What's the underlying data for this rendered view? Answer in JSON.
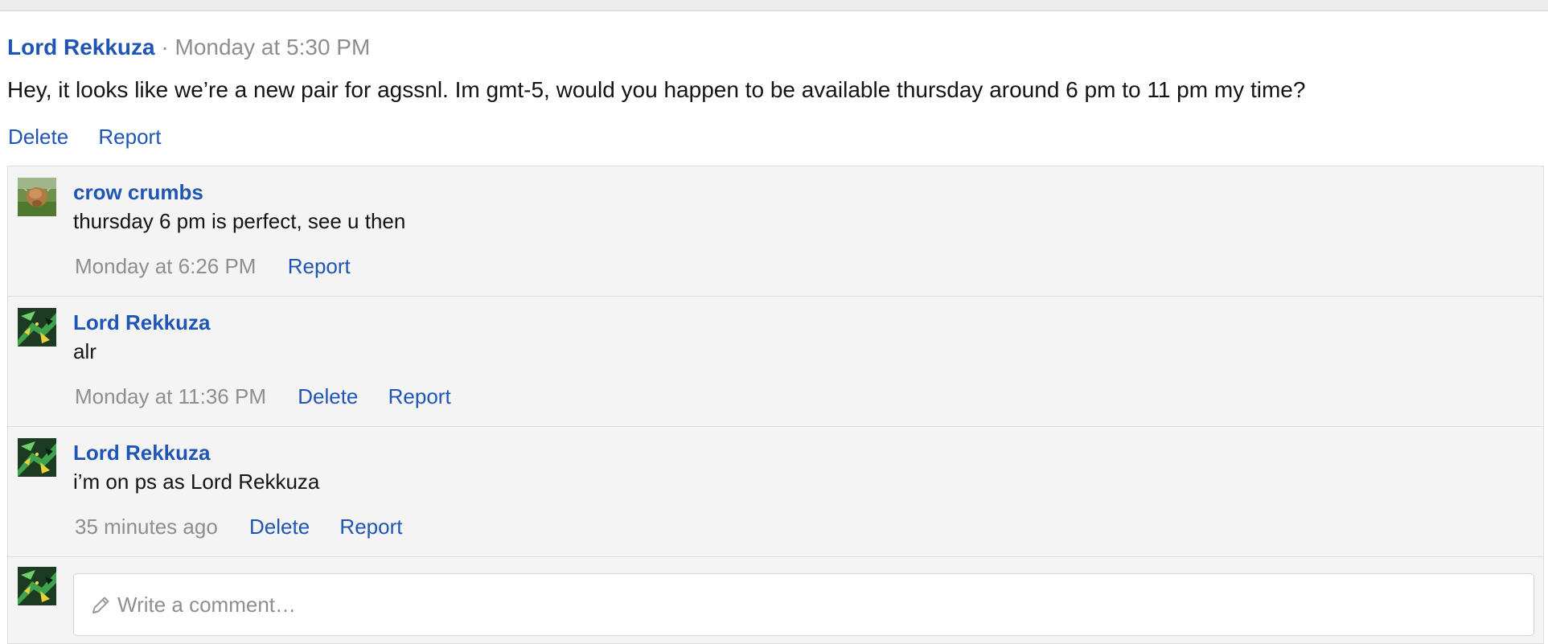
{
  "post": {
    "author": "Lord Rekkuza",
    "separator": "·",
    "timestamp": "Monday at 5:30 PM",
    "body": "Hey, it looks like we’re a new pair for agssnl. Im gmt-5, would you happen to be available thursday around 6 pm to 11 pm my time?",
    "actions": {
      "delete_label": "Delete",
      "report_label": "Report"
    }
  },
  "comments": [
    {
      "author": "crow crumbs",
      "text": "thursday 6 pm is perfect, see u then",
      "time": "Monday at 6:26 PM",
      "report_label": "Report",
      "avatar_icon": "highland-cow-photo"
    },
    {
      "author": "Lord Rekkuza",
      "text": "alr",
      "time": "Monday at 11:36 PM",
      "delete_label": "Delete",
      "report_label": "Report",
      "avatar_icon": "green-dragon-art"
    },
    {
      "author": "Lord Rekkuza",
      "text": "i’m on ps as Lord Rekkuza",
      "time": "35 minutes ago",
      "delete_label": "Delete",
      "report_label": "Report",
      "avatar_icon": "green-dragon-art"
    }
  ],
  "composer": {
    "placeholder": "Write a comment…",
    "icon": "pencil-icon",
    "avatar_icon": "green-dragon-art"
  },
  "colors": {
    "link": "#1f55b5",
    "muted": "#8e8e8e",
    "text": "#141414",
    "panel": "#f4f4f4",
    "border": "#dddddd"
  }
}
